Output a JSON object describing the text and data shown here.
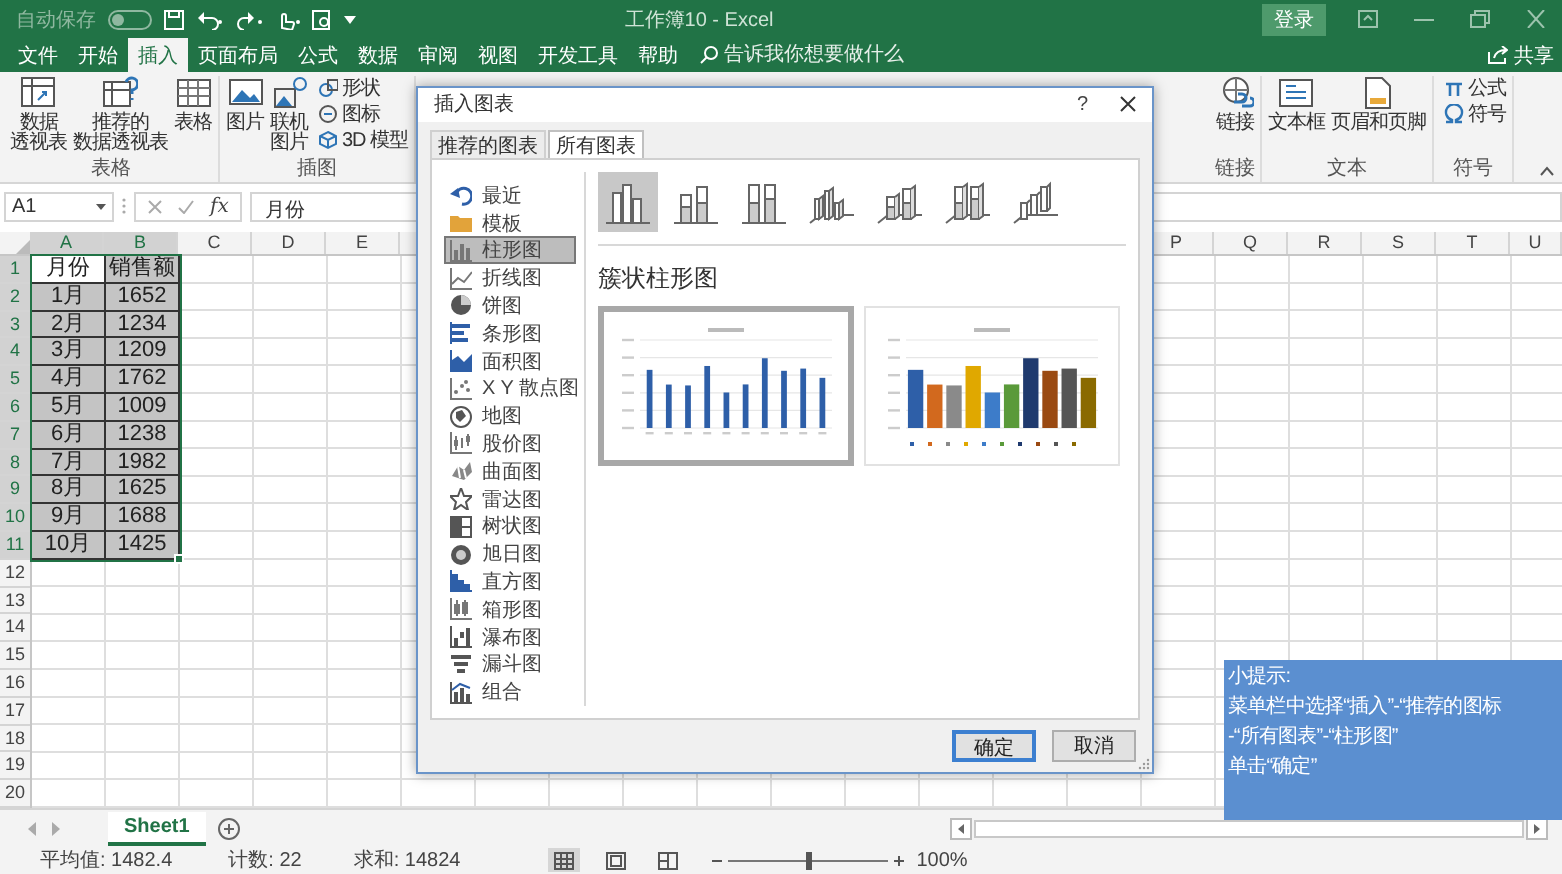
{
  "title_bar": {
    "autosave_label": "自动保存",
    "autosave_on": false,
    "title": "工作簿10 - Excel",
    "sign_in": "登录"
  },
  "tabs": [
    {
      "label": "文件",
      "selected": false
    },
    {
      "label": "开始",
      "selected": false
    },
    {
      "label": "插入",
      "selected": true
    },
    {
      "label": "页面布局",
      "selected": false
    },
    {
      "label": "公式",
      "selected": false
    },
    {
      "label": "数据",
      "selected": false
    },
    {
      "label": "审阅",
      "selected": false
    },
    {
      "label": "视图",
      "selected": false
    },
    {
      "label": "开发工具",
      "selected": false
    },
    {
      "label": "帮助",
      "selected": false
    }
  ],
  "tell_me": {
    "placeholder": "告诉我你想要做什么"
  },
  "share": "共享",
  "ribbon_left": [
    {
      "label": "表格",
      "items": [
        {
          "kind": "large",
          "lines": [
            "数据",
            "透视表"
          ]
        },
        {
          "kind": "large",
          "lines": [
            "推荐的",
            "数据透视表"
          ]
        },
        {
          "kind": "large",
          "lines": [
            "表格"
          ]
        }
      ]
    },
    {
      "label": "插图",
      "items": [
        {
          "kind": "large",
          "lines": [
            "图片"
          ]
        },
        {
          "kind": "large",
          "lines": [
            "联机",
            "图片"
          ]
        },
        {
          "kind": "small",
          "lines": [
            "形状"
          ]
        },
        {
          "kind": "small",
          "lines": [
            "图标"
          ]
        },
        {
          "kind": "small",
          "lines": [
            "3D 模型"
          ]
        }
      ]
    }
  ],
  "ribbon_right": [
    {
      "label": "链接",
      "items": [
        {
          "kind": "large",
          "lines": [
            "链接"
          ]
        }
      ]
    },
    {
      "label": "文本",
      "items": [
        {
          "kind": "large",
          "lines": [
            "文本框"
          ]
        },
        {
          "kind": "large",
          "lines": [
            "页眉和页脚"
          ]
        }
      ]
    },
    {
      "label": "符号",
      "items": [
        {
          "kind": "small",
          "lines": [
            "公式"
          ]
        },
        {
          "kind": "small",
          "lines": [
            "符号"
          ]
        }
      ]
    }
  ],
  "formula_bar": {
    "name_box": "A1",
    "function_button": "fx",
    "value": "月份"
  },
  "columns_left": [
    "A",
    "B",
    "C",
    "D",
    "E"
  ],
  "columns_right": [
    "P",
    "Q",
    "R",
    "S",
    "T",
    "U"
  ],
  "row_numbers": [
    "1",
    "2",
    "3",
    "4",
    "5",
    "6",
    "7",
    "8",
    "9",
    "10",
    "11",
    "12",
    "13",
    "14",
    "15",
    "16",
    "17",
    "18",
    "19",
    "20"
  ],
  "cells": [
    [
      {
        "text": "月份",
        "selected": true,
        "active": true
      },
      {
        "text": "销售额",
        "selected": true,
        "active": false
      }
    ],
    [
      {
        "text": "1月",
        "selected": true,
        "active": false
      },
      {
        "text": "1652",
        "selected": true,
        "active": false
      }
    ],
    [
      {
        "text": "2月",
        "selected": true,
        "active": false
      },
      {
        "text": "1234",
        "selected": true,
        "active": false
      }
    ],
    [
      {
        "text": "3月",
        "selected": true,
        "active": false
      },
      {
        "text": "1209",
        "selected": true,
        "active": false
      }
    ],
    [
      {
        "text": "4月",
        "selected": true,
        "active": false
      },
      {
        "text": "1762",
        "selected": true,
        "active": false
      }
    ],
    [
      {
        "text": "5月",
        "selected": true,
        "active": false
      },
      {
        "text": "1009",
        "selected": true,
        "active": false
      }
    ],
    [
      {
        "text": "6月",
        "selected": true,
        "active": false
      },
      {
        "text": "1238",
        "selected": true,
        "active": false
      }
    ],
    [
      {
        "text": "7月",
        "selected": true,
        "active": false
      },
      {
        "text": "1982",
        "selected": true,
        "active": false
      }
    ],
    [
      {
        "text": "8月",
        "selected": true,
        "active": false
      },
      {
        "text": "1625",
        "selected": true,
        "active": false
      }
    ],
    [
      {
        "text": "9月",
        "selected": true,
        "active": false
      },
      {
        "text": "1688",
        "selected": true,
        "active": false
      }
    ],
    [
      {
        "text": "10月",
        "selected": true,
        "active": false
      },
      {
        "text": "1425",
        "selected": true,
        "active": false
      }
    ]
  ],
  "sheets": [
    {
      "label": "Sheet1",
      "selected": true
    }
  ],
  "status_bar": {
    "average": "平均值: 1482.4",
    "count": "计数: 22",
    "sum": "求和: 14824",
    "views": [
      {
        "kind": "normal",
        "selected": true
      },
      {
        "kind": "page_layout",
        "selected": false
      },
      {
        "kind": "page_break",
        "selected": false
      }
    ],
    "zoom": {
      "level": 0.5,
      "reading": "100%"
    }
  },
  "dialog": {
    "title": "插入图表",
    "help": "?",
    "tabs": [
      {
        "label": "推荐的图表",
        "selected": false
      },
      {
        "label": "所有图表",
        "selected": true
      }
    ],
    "chart_types": [
      {
        "label": "最近",
        "selected": false
      },
      {
        "label": "模板",
        "selected": false
      },
      {
        "label": "柱形图",
        "selected": true
      },
      {
        "label": "折线图",
        "selected": false
      },
      {
        "label": "饼图",
        "selected": false
      },
      {
        "label": "条形图",
        "selected": false
      },
      {
        "label": "面积图",
        "selected": false
      },
      {
        "label": "X Y 散点图",
        "selected": false
      },
      {
        "label": "地图",
        "selected": false
      },
      {
        "label": "股价图",
        "selected": false
      },
      {
        "label": "曲面图",
        "selected": false
      },
      {
        "label": "雷达图",
        "selected": false
      },
      {
        "label": "树状图",
        "selected": false
      },
      {
        "label": "旭日图",
        "selected": false
      },
      {
        "label": "直方图",
        "selected": false
      },
      {
        "label": "箱形图",
        "selected": false
      },
      {
        "label": "瀑布图",
        "selected": false
      },
      {
        "label": "漏斗图",
        "selected": false
      },
      {
        "label": "组合",
        "selected": false
      }
    ],
    "subtypes": [
      {
        "selected": true
      },
      {
        "selected": false
      },
      {
        "selected": false
      },
      {
        "selected": false
      },
      {
        "selected": false
      },
      {
        "selected": false
      },
      {
        "selected": false
      }
    ],
    "heading": "簇状柱形图",
    "previews": [
      {
        "kind": "single_color",
        "selected": true
      },
      {
        "kind": "multi_color",
        "selected": false
      }
    ],
    "buttons": [
      {
        "label": "确定",
        "default": true
      },
      {
        "label": "取消",
        "default": false
      }
    ]
  },
  "tip": {
    "title": "小提示:",
    "lines": [
      "菜单栏中选择“插入”-“推荐的图标",
      "-“所有图表”-“柱形图”",
      "单击“确定”"
    ]
  }
}
